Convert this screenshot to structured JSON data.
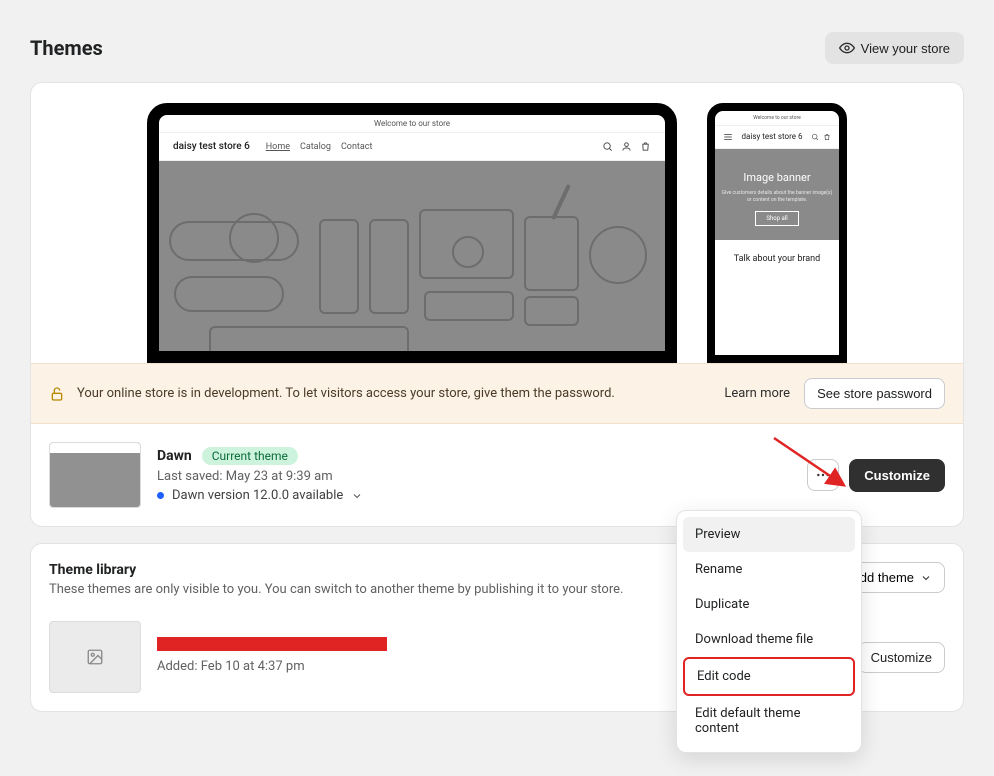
{
  "header": {
    "title": "Themes",
    "view_store": "View your store"
  },
  "store_preview": {
    "announce": "Welcome to our store",
    "store_name": "daisy test store 6",
    "nav_home": "Home",
    "nav_catalog": "Catalog",
    "nav_contact": "Contact",
    "mobile_banner_title": "Image banner",
    "mobile_banner_sub": "Give customers details about the banner image(s) or content on the template.",
    "mobile_banner_btn": "Shop all",
    "mobile_brand": "Talk about your brand"
  },
  "dev_banner": {
    "text": "Your online store is in development. To let visitors access your store, give them the password.",
    "learn_more": "Learn more",
    "see_password": "See store password"
  },
  "current_theme": {
    "name": "Dawn",
    "badge": "Current theme",
    "last_saved": "Last saved: May 23 at 9:39 am",
    "version_available": "Dawn version 12.0.0 available",
    "customize": "Customize"
  },
  "menu": {
    "preview": "Preview",
    "rename": "Rename",
    "duplicate": "Duplicate",
    "download": "Download theme file",
    "edit_code": "Edit code",
    "edit_default": "Edit default theme content"
  },
  "library": {
    "title": "Theme library",
    "sub": "These themes are only visible to you. You can switch to another theme by publishing it to your store.",
    "add_theme": "Add theme",
    "item_added": "Added: Feb 10 at 4:37 pm",
    "customize": "Customize"
  }
}
